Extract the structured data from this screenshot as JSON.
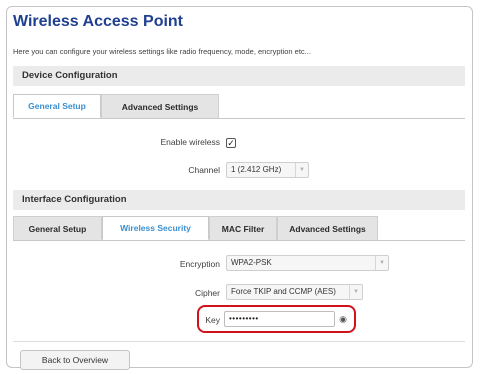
{
  "page": {
    "title": "Wireless Access Point",
    "description": "Here you can configure your wireless settings like radio frequency, mode, encryption etc..."
  },
  "device_config": {
    "heading": "Device Configuration",
    "tabs": [
      {
        "label": "General Setup",
        "active": true
      },
      {
        "label": "Advanced Settings",
        "active": false
      }
    ],
    "enable_wireless": {
      "label": "Enable wireless",
      "checked": true,
      "check_glyph": "✓"
    },
    "channel": {
      "label": "Channel",
      "value": "1 (2.412 GHz)"
    }
  },
  "interface_config": {
    "heading": "Interface Configuration",
    "tabs": [
      {
        "label": "General Setup",
        "active": false
      },
      {
        "label": "Wireless Security",
        "active": true
      },
      {
        "label": "MAC Filter",
        "active": false
      },
      {
        "label": "Advanced Settings",
        "active": false
      }
    ],
    "encryption": {
      "label": "Encryption",
      "value": "WPA2-PSK"
    },
    "cipher": {
      "label": "Cipher",
      "value": "Force TKIP and CCMP (AES)"
    },
    "key": {
      "label": "Key",
      "value": "•••••••••",
      "toggle_icon": "eye-icon"
    }
  },
  "footer": {
    "back_button": "Back to Overview"
  },
  "colors": {
    "title": "#1f3f8f",
    "active_tab": "#3a8fd1",
    "highlight": "#d2121b"
  }
}
